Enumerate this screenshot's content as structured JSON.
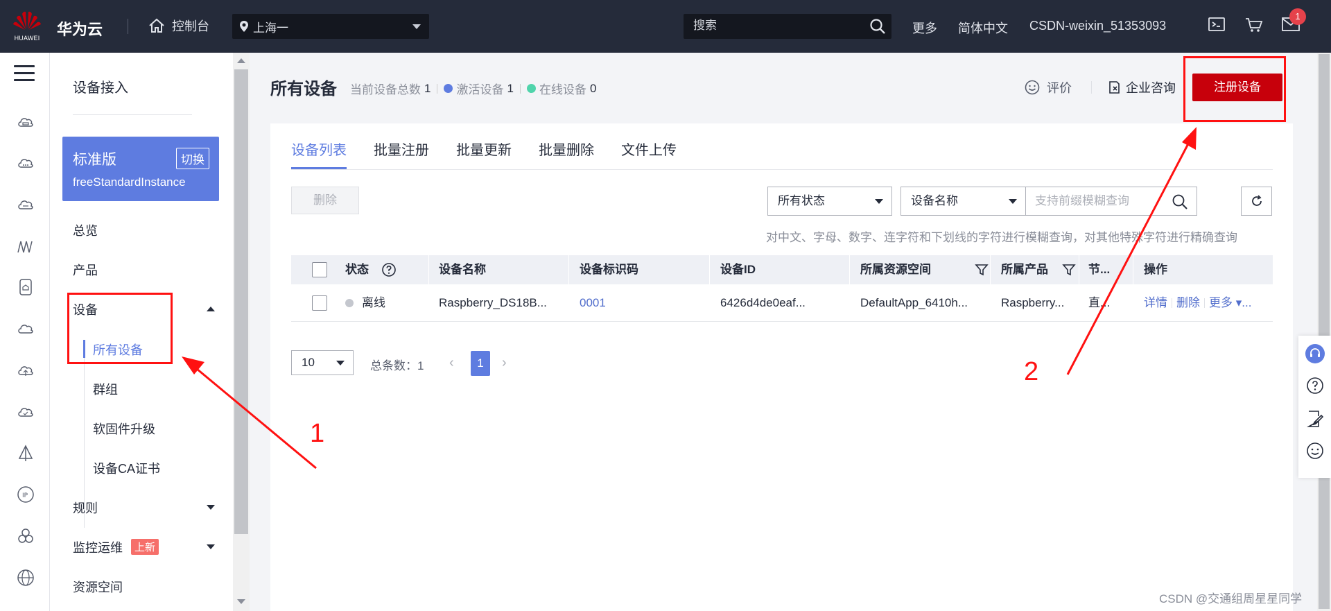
{
  "topbar": {
    "logo_text": "HUAWEI",
    "brand": "华为云",
    "console": "控制台",
    "region": "上海一",
    "search_placeholder": "搜索",
    "more": "更多",
    "language": "简体中文",
    "account": "CSDN-weixin_51353093",
    "message_count": "1"
  },
  "sidenav": {
    "title": "设备接入",
    "edition_name": "标准版",
    "edition_switch": "切换",
    "instance": "freeStandardInstance",
    "items": [
      {
        "label": "总览"
      },
      {
        "label": "产品"
      },
      {
        "label": "设备"
      },
      {
        "label": "所有设备"
      },
      {
        "label": "群组"
      },
      {
        "label": "软固件升级"
      },
      {
        "label": "设备CA证书"
      },
      {
        "label": "规则"
      },
      {
        "label": "监控运维"
      },
      {
        "label": "资源空间"
      }
    ],
    "new_tag": "上新"
  },
  "header": {
    "title": "所有设备",
    "total_label": "当前设备总数",
    "total_value": "1",
    "active_label": "激活设备",
    "active_value": "1",
    "online_label": "在线设备",
    "online_value": "0",
    "rate": "评价",
    "consult": "企业咨询",
    "register": "注册设备"
  },
  "colors": {
    "active_dot": "#5e7ce0",
    "online_dot": "#50d4ab",
    "primary": "#5e7ce0",
    "brand_red": "#c7000b",
    "annotation": "#ff1111"
  },
  "tabs": [
    {
      "label": "设备列表"
    },
    {
      "label": "批量注册"
    },
    {
      "label": "批量更新"
    },
    {
      "label": "批量删除"
    },
    {
      "label": "文件上传"
    }
  ],
  "toolbar": {
    "delete": "删除",
    "status_filter": "所有状态",
    "field_filter": "设备名称",
    "query_placeholder": "支持前缀模糊查询",
    "hint": "对中文、字母、数字、连字符和下划线的字符进行模糊查询，对其他特殊字符进行精确查询"
  },
  "table": {
    "columns": [
      "状态",
      "设备名称",
      "设备标识码",
      "设备ID",
      "所属资源空间",
      "所属产品",
      "节...",
      "操作"
    ],
    "rows": [
      {
        "status": "离线",
        "name": "Raspberry_DS18B...",
        "code": "0001",
        "id": "6426d4de0eaf...",
        "space": "DefaultApp_6410h...",
        "product": "Raspberry...",
        "node": "直...",
        "actions": [
          "详情",
          "删除",
          "更多 ▾..."
        ]
      }
    ]
  },
  "pager": {
    "page_size": "10",
    "total_label": "总条数：",
    "total": "1",
    "current": "1"
  },
  "annotations": {
    "one": "1",
    "two": "2"
  },
  "watermark": "CSDN @交通组周星星同学"
}
